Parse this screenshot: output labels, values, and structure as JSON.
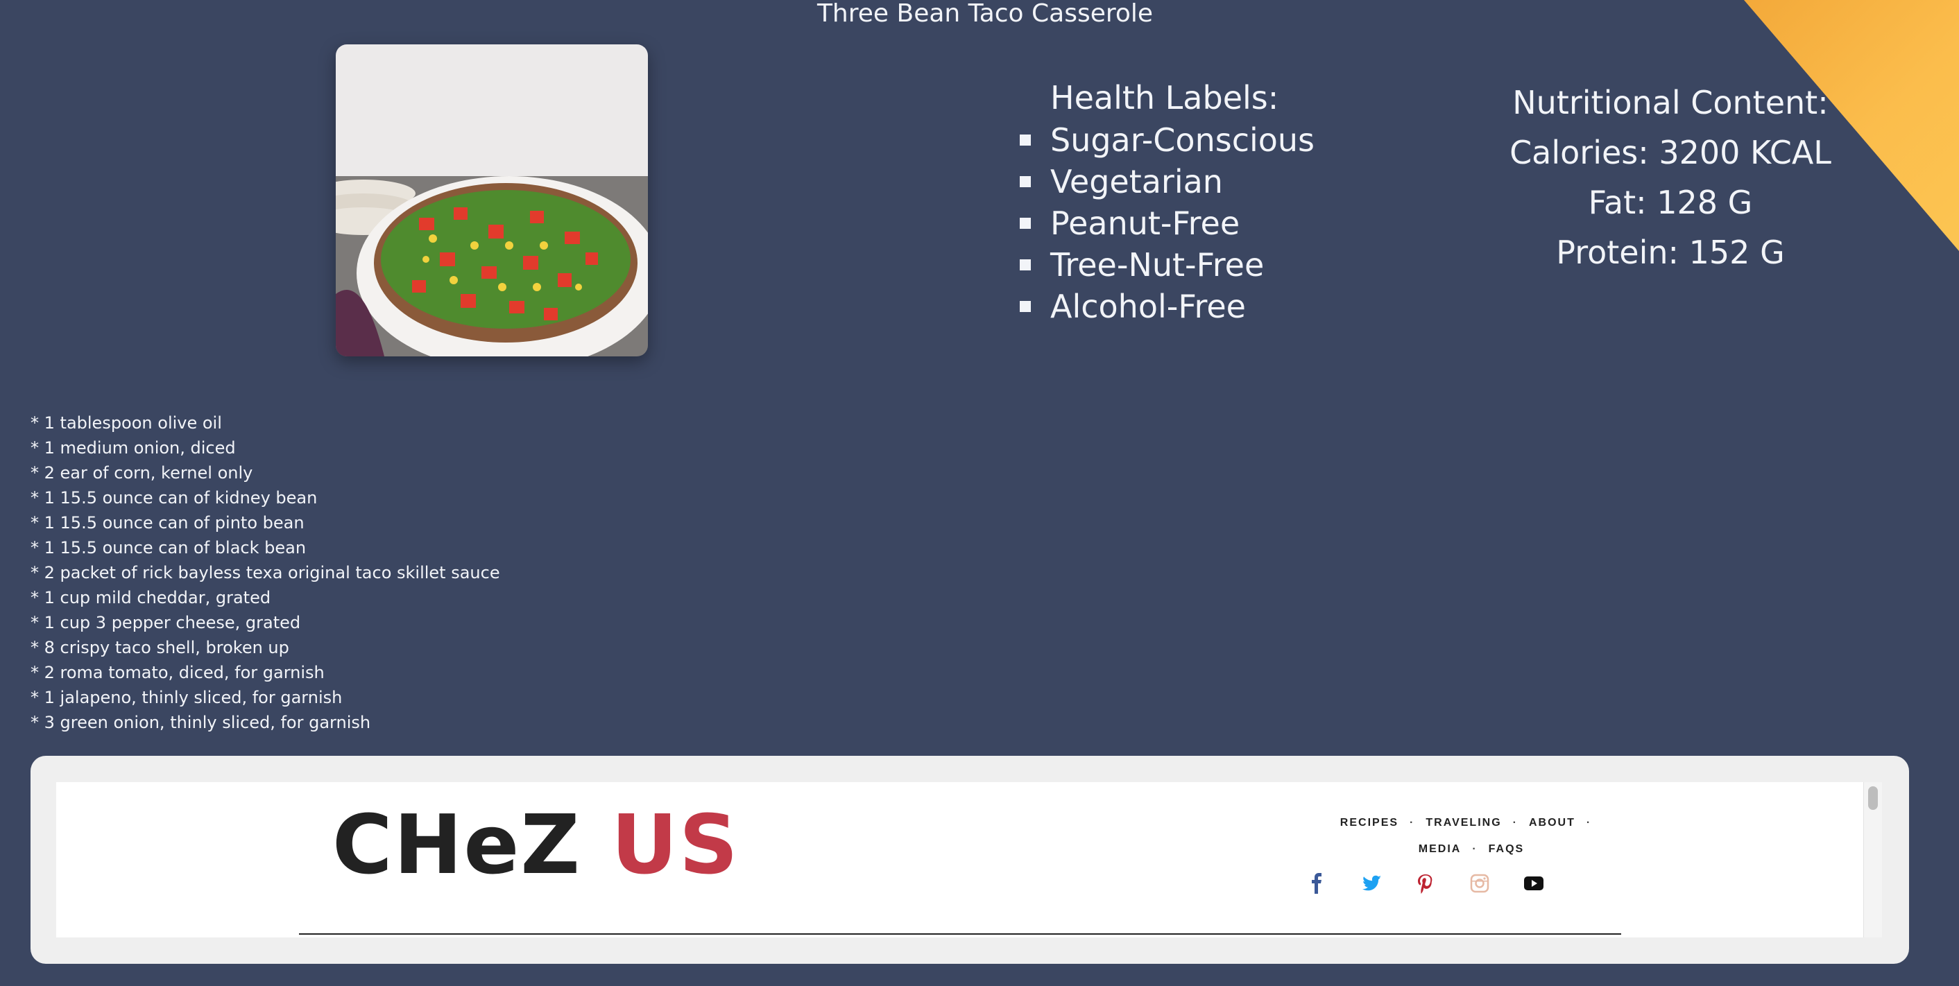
{
  "recipe": {
    "title": "Three Bean Taco Casserole",
    "image_alt": "Three Bean Taco Casserole"
  },
  "health_labels": {
    "heading": "Health Labels:",
    "items": [
      "Sugar-Conscious",
      "Vegetarian",
      "Peanut-Free",
      "Tree-Nut-Free",
      "Alcohol-Free"
    ]
  },
  "nutrition": {
    "heading": "Nutritional Content:",
    "calories": "Calories: 3200 KCAL",
    "fat": "Fat: 128 G",
    "protein": "Protein: 152 G"
  },
  "ingredients": [
    "* 1 tablespoon olive oil",
    "* 1 medium onion, diced",
    "* 2 ear of corn, kernel only",
    "* 1 15.5 ounce can of kidney bean",
    "* 1 15.5 ounce can of pinto bean",
    "* 1 15.5 ounce can of black bean",
    "* 2 packet of rick bayless texa original taco skillet sauce",
    "* 1 cup mild cheddar, grated",
    "* 1 cup 3 pepper cheese, grated",
    "* 8 crispy taco shell, broken up",
    "* 2 roma tomato, diced, for garnish",
    "* 1 jalapeno, thinly sliced, for garnish",
    "* 3 green onion, thinly sliced, for garnish"
  ],
  "embedded_site": {
    "logo_part1": "CHeZ",
    "logo_part2": "US",
    "nav_row1": [
      "RECIPES",
      "TRAVELING",
      "ABOUT"
    ],
    "nav_row2": [
      "MEDIA",
      "FAQS"
    ],
    "nav_separator": "·",
    "social": [
      "facebook-icon",
      "twitter-icon",
      "pinterest-icon",
      "instagram-icon",
      "youtube-icon"
    ]
  },
  "colors": {
    "page_background": "#3b4661",
    "accent_corner": "#fbbd4c",
    "logo_accent": "#c23a48"
  }
}
